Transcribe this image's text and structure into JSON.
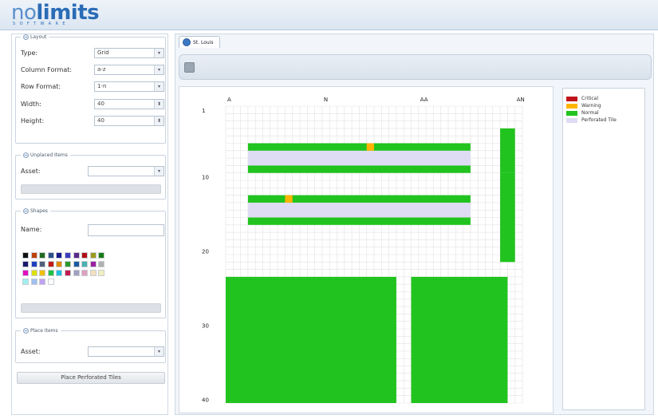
{
  "logo": {
    "prefix": "no",
    "rest": "limits",
    "tagline": "SOFTWARE"
  },
  "colors": {
    "critical": "#c0141b",
    "warning": "#ffb400",
    "normal": "#21c31e",
    "perforated": "#dedcf4",
    "accent": "#2a6cb6"
  },
  "layout_panel": {
    "legend": "Layout",
    "type_label": "Type:",
    "type_value": "Grid",
    "column_format_label": "Column Format:",
    "column_format_value": "a-z",
    "row_format_label": "Row Format:",
    "row_format_value": "1-n",
    "width_label": "Width:",
    "width_value": "40",
    "height_label": "Height:",
    "height_value": "40"
  },
  "unplaced_panel": {
    "legend": "Unplaced Items",
    "asset_label": "Asset:"
  },
  "shapes_panel": {
    "legend": "Shapes",
    "name_label": "Name:",
    "swatches": [
      "#111111",
      "#c0400b",
      "#1f6b1f",
      "#2b4f87",
      "#1a1a8a",
      "#3a3ac0",
      "#5a2a8a",
      "#b01010",
      "#9a9a20",
      "#187a18",
      "#1a1a6a",
      "#2040c0",
      "#50607a",
      "#c01a1a",
      "#e08a00",
      "#2a9a2a",
      "#1a5aa0",
      "#4ab0b0",
      "#9a20a0",
      "#b0b0b0",
      "#e010c0",
      "#e0e000",
      "#f0c000",
      "#20c040",
      "#20c0e0",
      "#c01a50",
      "#a0a0c0",
      "#e0a0c0",
      "#f0e0c0",
      "#f0f0c0",
      "#a0f0f0",
      "#a0c0f0",
      "#c0a0f0",
      "#ffffff"
    ]
  },
  "place_panel": {
    "legend": "Place Items",
    "asset_label": "Asset:"
  },
  "place_tiles_button": "Place Perforated Tiles",
  "tab": {
    "label": "St. Louis"
  },
  "grid": {
    "columns": 40,
    "rows": 40,
    "col_labels": [
      "A",
      "N",
      "AA",
      "AN"
    ],
    "row_labels": [
      "1",
      "10",
      "20",
      "30",
      "40"
    ]
  },
  "legend": [
    {
      "label": "Critical",
      "color": "#c0141b"
    },
    {
      "label": "Warning",
      "color": "#ffb400"
    },
    {
      "label": "Normal",
      "color": "#21c31e"
    },
    {
      "label": "Perforated Tile",
      "color": "#dedcf4"
    }
  ]
}
